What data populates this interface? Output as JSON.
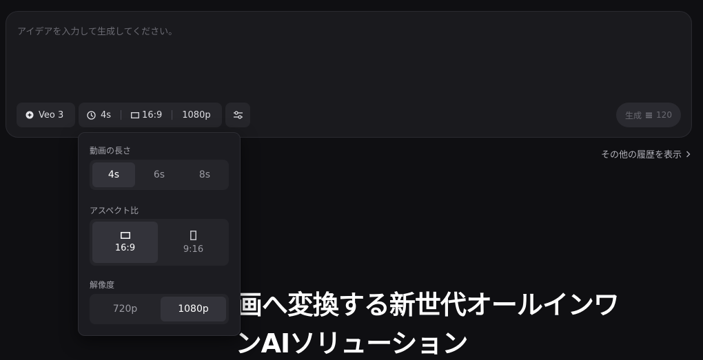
{
  "composer": {
    "placeholder": "アイデアを入力して生成してください。"
  },
  "toolbar": {
    "model_label": "Veo 3",
    "duration_label": "4s",
    "aspect_label": "16:9",
    "resolution_label": "1080p",
    "generate_label": "生成",
    "credits": "120"
  },
  "history_link": "その他の履歴を表示",
  "hero": {
    "line1": "テキストを動画へ変換する新世代オールインワ",
    "line2": "ンAIソリューション"
  },
  "dropdown": {
    "duration": {
      "label": "動画の長さ",
      "options": [
        "4s",
        "6s",
        "8s"
      ],
      "selected": "4s"
    },
    "aspect": {
      "label": "アスペクト比",
      "options": [
        "16:9",
        "9:16"
      ],
      "selected": "16:9"
    },
    "resolution": {
      "label": "解像度",
      "options": [
        "720p",
        "1080p"
      ],
      "selected": "1080p"
    }
  },
  "colors": {
    "background": "#0f0f12",
    "panel": "#1a1a1e",
    "chip": "#26262b",
    "active_option": "#33333a",
    "muted_text": "#9a9aa2"
  }
}
